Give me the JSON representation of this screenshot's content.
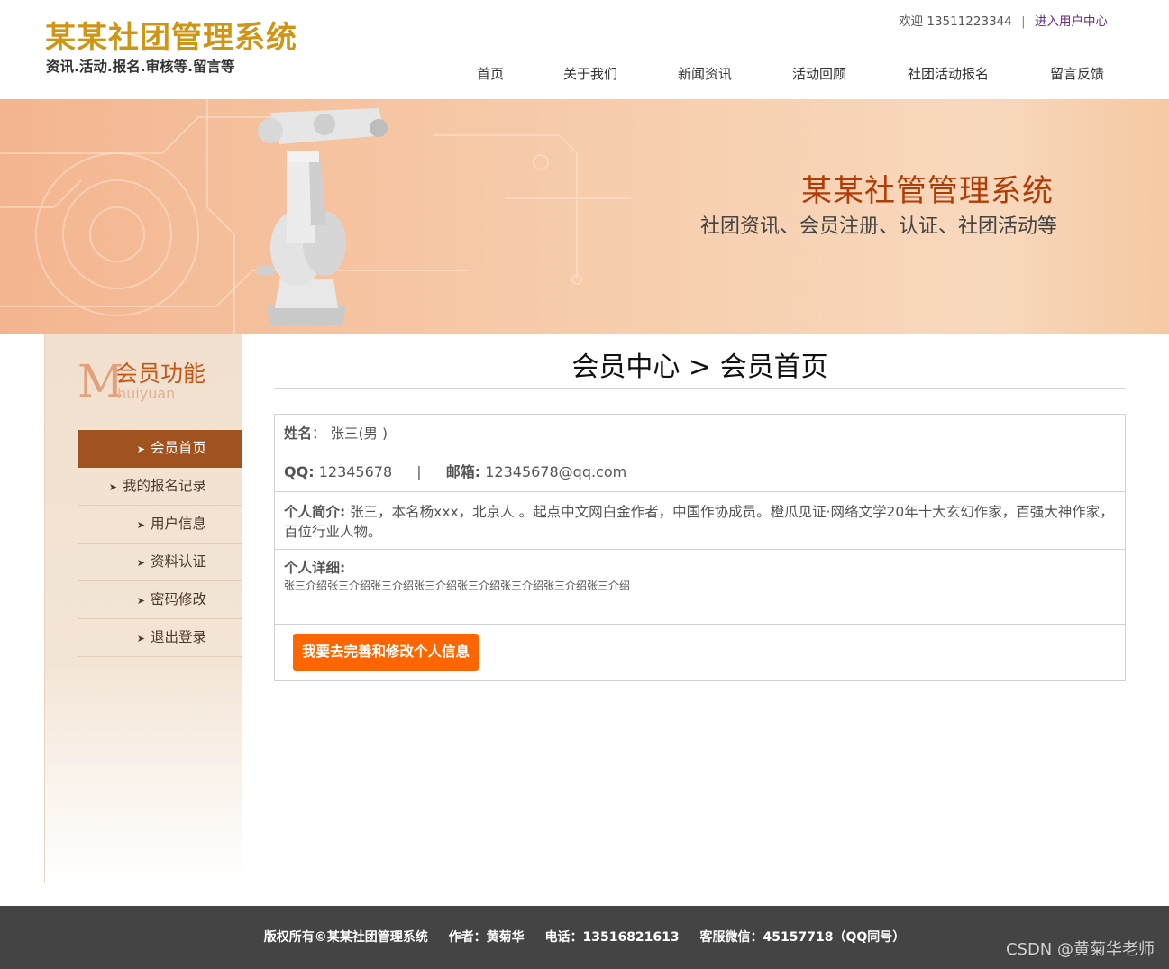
{
  "header": {
    "logo_title": "某某社团管理系统",
    "logo_subtitle": "资讯.活动.报名.审核等.留言等",
    "welcome": "欢迎 13511223344",
    "separator": "|",
    "user_center_link": "进入用户中心",
    "nav": [
      "首页",
      "关于我们",
      "新闻资讯",
      "活动回顾",
      "社团活动报名",
      "留言反馈"
    ]
  },
  "banner": {
    "title": "某某社管管理系统",
    "subtitle": "社团资讯、会员注册、认证、社团活动等"
  },
  "sidebar": {
    "logo_letter": "M",
    "logo_cn": "会员功能",
    "logo_en": "huiyuan",
    "items": [
      {
        "label": "会员首页",
        "active": true
      },
      {
        "label": "我的报名记录",
        "active": false
      },
      {
        "label": "用户信息",
        "active": false
      },
      {
        "label": "资料认证",
        "active": false
      },
      {
        "label": "密码修改",
        "active": false
      },
      {
        "label": "退出登录",
        "active": false
      }
    ]
  },
  "main": {
    "title": "会员中心 > 会员首页",
    "name_label": "姓名",
    "name_value": "张三(男 )",
    "qq_label": "QQ:",
    "qq_value": "12345678",
    "divider": "|",
    "email_label": "邮箱:",
    "email_value": "12345678@qq.com",
    "intro_label": "个人简介:",
    "intro_value": "张三，本名杨xxx，北京人 。起点中文网白金作者，中国作协成员。橙瓜见证·网络文学20年十大玄幻作家，百强大神作家，百位行业人物。",
    "detail_label": "个人详细:",
    "detail_value": "张三介绍张三介绍张三介绍张三介绍张三介绍张三介绍张三介绍张三介绍",
    "edit_button": "我要去完善和修改个人信息"
  },
  "footer": {
    "copyright": "版权所有©某某社团管理系统",
    "author": "作者：黄菊华",
    "phone": "电话：13516821613",
    "wechat": "客服微信：45157718（QQ同号）",
    "watermark": "CSDN @黄菊华老师"
  },
  "colors": {
    "brand_gold": "#cf9514",
    "banner_title": "#b23c06",
    "sidebar_active": "#a0521f",
    "button": "#ff6600",
    "footer_bg": "#444444"
  }
}
